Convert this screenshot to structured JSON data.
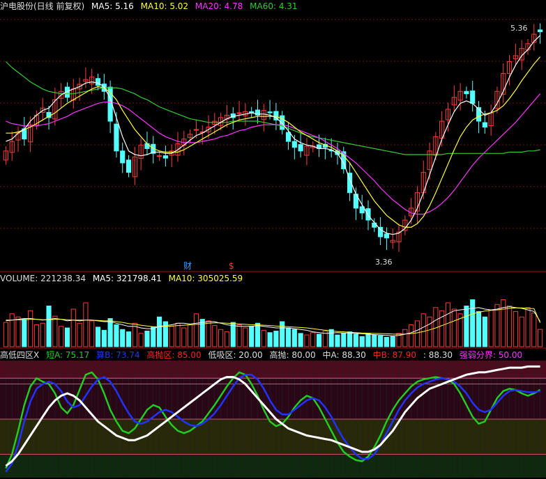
{
  "colors": {
    "bg": "#000000",
    "up": "#ff3b3b",
    "down": "#54ffff",
    "ma5": "#ffffff",
    "ma10": "#ffff33",
    "ma20": "#ff33ff",
    "ma60": "#33cc33",
    "grid": "#7a1010",
    "fin_blue": "#3aa0ff",
    "short_green": "#22cc22",
    "mid_blue": "#2233ff",
    "high_red": "#ff2222",
    "low_white": "#ffffff",
    "strength_magenta": "#ff33ff"
  },
  "chart_data": [
    {
      "type": "candlestick",
      "title": "沪电股份(日线 前复权)",
      "legend": [
        {
          "key": "ma5",
          "label": "MA5: 5.16"
        },
        {
          "key": "ma10",
          "label": "MA10: 5.02"
        },
        {
          "key": "ma20",
          "label": "MA20: 4.78"
        },
        {
          "key": "ma60",
          "label": "MA60: 4.31"
        }
      ],
      "annotations": {
        "high": "5.36",
        "low": "3.36",
        "finance_marker": "财",
        "dollar_marker": "$"
      },
      "ylim": [
        3.3,
        5.45
      ],
      "close": [
        4.3,
        4.38,
        4.45,
        4.4,
        4.52,
        4.6,
        4.66,
        4.58,
        4.73,
        4.8,
        4.75,
        4.82,
        4.86,
        4.9,
        4.92,
        4.85,
        4.8,
        4.55,
        4.3,
        4.2,
        4.12,
        4.25,
        4.35,
        4.32,
        4.28,
        4.26,
        4.24,
        4.3,
        4.36,
        4.4,
        4.44,
        4.48,
        4.46,
        4.5,
        4.55,
        4.58,
        4.6,
        4.58,
        4.62,
        4.63,
        4.62,
        4.6,
        4.64,
        4.62,
        4.56,
        4.48,
        4.38,
        4.33,
        4.3,
        4.34,
        4.34,
        4.32,
        4.33,
        4.3,
        4.27,
        4.15,
        3.95,
        3.82,
        3.78,
        3.72,
        3.66,
        3.58,
        3.57,
        3.55,
        3.62,
        3.72,
        3.82,
        3.95,
        4.12,
        4.3,
        4.42,
        4.55,
        4.65,
        4.75,
        4.8,
        4.78,
        4.7,
        4.55,
        4.5,
        4.62,
        4.8,
        4.95,
        5.05,
        5.1,
        5.16,
        5.2,
        5.28,
        5.3
      ],
      "ma5": [
        4.38,
        4.4,
        4.45,
        4.48,
        4.55,
        4.6,
        4.64,
        4.66,
        4.72,
        4.77,
        4.8,
        4.82,
        4.84,
        4.87,
        4.88,
        4.87,
        4.84,
        4.74,
        4.58,
        4.42,
        4.3,
        4.27,
        4.26,
        4.27,
        4.29,
        4.29,
        4.28,
        4.28,
        4.31,
        4.35,
        4.39,
        4.43,
        4.45,
        4.48,
        4.51,
        4.54,
        4.57,
        4.59,
        4.6,
        4.61,
        4.62,
        4.61,
        4.61,
        4.6,
        4.58,
        4.53,
        4.47,
        4.4,
        4.37,
        4.35,
        4.34,
        4.32,
        4.32,
        4.31,
        4.28,
        4.2,
        4.06,
        3.94,
        3.85,
        3.76,
        3.7,
        3.64,
        3.61,
        3.6,
        3.61,
        3.65,
        3.72,
        3.82,
        3.95,
        4.1,
        4.25,
        4.4,
        4.52,
        4.63,
        4.7,
        4.72,
        4.7,
        4.65,
        4.6,
        4.62,
        4.7,
        4.8,
        4.92,
        5.02,
        5.1,
        5.15,
        5.22,
        5.27
      ],
      "ma10": [
        4.45,
        4.45,
        4.46,
        4.48,
        4.5,
        4.53,
        4.56,
        4.59,
        4.62,
        4.66,
        4.7,
        4.73,
        4.76,
        4.79,
        4.82,
        4.84,
        4.83,
        4.79,
        4.73,
        4.64,
        4.56,
        4.48,
        4.42,
        4.36,
        4.32,
        4.3,
        4.29,
        4.29,
        4.29,
        4.31,
        4.34,
        4.37,
        4.4,
        4.43,
        4.46,
        4.49,
        4.52,
        4.54,
        4.56,
        4.57,
        4.58,
        4.59,
        4.59,
        4.59,
        4.59,
        4.57,
        4.54,
        4.5,
        4.46,
        4.43,
        4.4,
        4.37,
        4.35,
        4.33,
        4.3,
        4.26,
        4.2,
        4.12,
        4.04,
        3.96,
        3.88,
        3.82,
        3.76,
        3.72,
        3.68,
        3.66,
        3.66,
        3.69,
        3.75,
        3.84,
        3.95,
        4.07,
        4.19,
        4.31,
        4.42,
        4.5,
        4.56,
        4.59,
        4.61,
        4.62,
        4.64,
        4.68,
        4.74,
        4.81,
        4.89,
        4.96,
        5.03,
        5.09
      ],
      "ma20": [
        4.55,
        4.53,
        4.52,
        4.51,
        4.51,
        4.51,
        4.52,
        4.53,
        4.55,
        4.57,
        4.59,
        4.62,
        4.64,
        4.66,
        4.68,
        4.7,
        4.71,
        4.71,
        4.7,
        4.68,
        4.65,
        4.61,
        4.57,
        4.53,
        4.49,
        4.45,
        4.42,
        4.4,
        4.38,
        4.37,
        4.37,
        4.37,
        4.38,
        4.39,
        4.4,
        4.42,
        4.43,
        4.45,
        4.47,
        4.48,
        4.5,
        4.51,
        4.52,
        4.52,
        4.52,
        4.52,
        4.51,
        4.49,
        4.47,
        4.45,
        4.43,
        4.41,
        4.38,
        4.35,
        4.32,
        4.28,
        4.24,
        4.2,
        4.15,
        4.1,
        4.05,
        3.99,
        3.94,
        3.89,
        3.85,
        3.81,
        3.78,
        3.77,
        3.77,
        3.79,
        3.82,
        3.86,
        3.91,
        3.97,
        4.04,
        4.11,
        4.18,
        4.24,
        4.29,
        4.34,
        4.39,
        4.44,
        4.49,
        4.54,
        4.6,
        4.66,
        4.72,
        4.78
      ],
      "ma60": [
        5.05,
        5.0,
        4.96,
        4.92,
        4.88,
        4.85,
        4.82,
        4.8,
        4.79,
        4.78,
        4.78,
        4.78,
        4.79,
        4.8,
        4.81,
        4.82,
        4.83,
        4.83,
        4.83,
        4.82,
        4.8,
        4.78,
        4.75,
        4.73,
        4.7,
        4.67,
        4.65,
        4.63,
        4.61,
        4.59,
        4.57,
        4.56,
        4.55,
        4.54,
        4.54,
        4.54,
        4.54,
        4.55,
        4.55,
        4.55,
        4.55,
        4.55,
        4.54,
        4.53,
        4.52,
        4.51,
        4.49,
        4.47,
        4.45,
        4.43,
        4.42,
        4.41,
        4.4,
        4.39,
        4.38,
        4.37,
        4.36,
        4.35,
        4.34,
        4.33,
        4.32,
        4.31,
        4.3,
        4.29,
        4.28,
        4.27,
        4.27,
        4.27,
        4.27,
        4.27,
        4.27,
        4.27,
        4.28,
        4.28,
        4.28,
        4.28,
        4.28,
        4.28,
        4.28,
        4.28,
        4.28,
        4.28,
        4.29,
        4.29,
        4.29,
        4.3,
        4.3,
        4.31
      ]
    },
    {
      "type": "bar",
      "title": "VOLUME",
      "legend": [
        {
          "key": "vol",
          "label": "VOLUME: 221238.34"
        },
        {
          "key": "ma5",
          "label": "MA5: 321798.41"
        },
        {
          "key": "ma10",
          "label": "MA10: 305025.59"
        }
      ],
      "ylim": [
        0,
        800000
      ],
      "volume": [
        310000,
        420000,
        380000,
        350000,
        460000,
        280000,
        300000,
        520000,
        390000,
        260000,
        240000,
        480000,
        300000,
        560000,
        330000,
        250000,
        210000,
        360000,
        280000,
        220000,
        190000,
        300000,
        170000,
        200000,
        250000,
        380000,
        320000,
        260000,
        300000,
        240000,
        280000,
        420000,
        350000,
        330000,
        270000,
        220000,
        190000,
        310000,
        280000,
        240000,
        260000,
        300000,
        210000,
        180000,
        200000,
        320000,
        240000,
        220000,
        170000,
        150000,
        180000,
        160000,
        200000,
        220000,
        150000,
        170000,
        190000,
        160000,
        130000,
        170000,
        150000,
        140000,
        120000,
        130000,
        170000,
        220000,
        280000,
        330000,
        420000,
        380000,
        500000,
        460000,
        560000,
        480000,
        420000,
        520000,
        600000,
        450000,
        380000,
        470000,
        540000,
        600000,
        520000,
        450000,
        380000,
        500000,
        430000,
        221238
      ],
      "ma5": [
        330000,
        340000,
        350000,
        360000,
        360000,
        350000,
        340000,
        350000,
        360000,
        350000,
        330000,
        340000,
        330000,
        340000,
        340000,
        330000,
        320000,
        320000,
        300000,
        280000,
        260000,
        260000,
        240000,
        230000,
        230000,
        260000,
        270000,
        280000,
        300000,
        300000,
        290000,
        300000,
        310000,
        320000,
        320000,
        300000,
        280000,
        270000,
        260000,
        260000,
        260000,
        270000,
        260000,
        250000,
        240000,
        240000,
        240000,
        230000,
        220000,
        210000,
        190000,
        180000,
        170000,
        175000,
        180000,
        175000,
        175000,
        170000,
        165000,
        160000,
        155000,
        150000,
        145000,
        140000,
        145000,
        160000,
        180000,
        210000,
        250000,
        290000,
        340000,
        380000,
        420000,
        460000,
        470000,
        480000,
        490000,
        500000,
        480000,
        470000,
        480000,
        500000,
        510000,
        500000,
        490000,
        470000,
        450000,
        321798
      ],
      "ma10": [
        340000,
        340000,
        345000,
        345000,
        350000,
        350000,
        345000,
        345000,
        350000,
        350000,
        345000,
        340000,
        340000,
        340000,
        340000,
        335000,
        330000,
        330000,
        320000,
        310000,
        295000,
        285000,
        275000,
        265000,
        255000,
        255000,
        260000,
        265000,
        270000,
        275000,
        280000,
        285000,
        290000,
        300000,
        305000,
        305000,
        300000,
        295000,
        290000,
        285000,
        280000,
        280000,
        275000,
        270000,
        265000,
        260000,
        255000,
        250000,
        245000,
        240000,
        230000,
        220000,
        210000,
        200000,
        195000,
        190000,
        185000,
        180000,
        175000,
        172000,
        170000,
        168000,
        165000,
        162000,
        160000,
        162000,
        168000,
        178000,
        195000,
        215000,
        240000,
        270000,
        300000,
        330000,
        360000,
        390000,
        420000,
        440000,
        455000,
        465000,
        470000,
        480000,
        490000,
        495000,
        495000,
        490000,
        485000,
        305025
      ]
    },
    {
      "type": "line",
      "title": "高低四区X",
      "legend": [
        {
          "key": "short",
          "label": "短A: 75.17"
        },
        {
          "key": "mid",
          "label": "算B: 73.74"
        },
        {
          "key": "hiZone",
          "label": "高抛区: 85.00"
        },
        {
          "key": "loZone",
          "label": "低吸区: 20.00"
        },
        {
          "key": "hiThrow",
          "label": "高抛: 80.00"
        },
        {
          "key": "midA",
          "label": "中A: 88.30"
        },
        {
          "key": "midB",
          "label": "中B: 87.90"
        },
        {
          "key": "unnamed",
          "label": ": 88.30"
        },
        {
          "key": "strength",
          "label": "强弱分界: 50.00"
        }
      ],
      "ylim": [
        0,
        100
      ],
      "short_a": [
        8,
        20,
        40,
        62,
        78,
        85,
        82,
        80,
        72,
        60,
        55,
        62,
        75,
        88,
        90,
        84,
        72,
        58,
        48,
        40,
        38,
        42,
        50,
        58,
        62,
        60,
        52,
        45,
        40,
        38,
        40,
        44,
        48,
        55,
        62,
        70,
        78,
        85,
        90,
        88,
        80,
        70,
        58,
        48,
        44,
        46,
        52,
        60,
        66,
        70,
        68,
        60,
        50,
        40,
        30,
        22,
        18,
        15,
        14,
        18,
        26,
        36,
        48,
        58,
        66,
        72,
        78,
        82,
        84,
        85,
        86,
        85,
        84,
        80,
        72,
        62,
        52,
        46,
        48,
        58,
        68,
        74,
        76,
        75,
        72,
        70,
        72,
        75
      ],
      "mid_b": [
        5,
        12,
        28,
        48,
        65,
        76,
        80,
        82,
        80,
        74,
        65,
        60,
        62,
        70,
        78,
        84,
        86,
        82,
        74,
        64,
        55,
        48,
        46,
        48,
        52,
        56,
        58,
        56,
        52,
        48,
        45,
        44,
        46,
        50,
        55,
        62,
        70,
        78,
        85,
        88,
        88,
        84,
        76,
        66,
        58,
        54,
        54,
        58,
        62,
        66,
        68,
        66,
        60,
        52,
        42,
        33,
        26,
        20,
        16,
        16,
        20,
        28,
        38,
        48,
        58,
        66,
        72,
        77,
        80,
        82,
        84,
        85,
        84,
        82,
        78,
        72,
        64,
        58,
        56,
        58,
        64,
        70,
        74,
        75,
        74,
        73,
        73,
        74
      ],
      "long_line": [
        10,
        14,
        20,
        28,
        36,
        44,
        52,
        60,
        66,
        70,
        72,
        70,
        66,
        60,
        54,
        48,
        44,
        40,
        36,
        34,
        32,
        32,
        34,
        36,
        40,
        44,
        48,
        52,
        56,
        60,
        64,
        68,
        72,
        76,
        80,
        84,
        86,
        86,
        84,
        80,
        74,
        68,
        62,
        56,
        50,
        46,
        42,
        40,
        38,
        36,
        35,
        34,
        33,
        32,
        30,
        28,
        26,
        24,
        22,
        22,
        24,
        28,
        34,
        40,
        48,
        56,
        62,
        68,
        72,
        76,
        78,
        80,
        82,
        84,
        86,
        88,
        89,
        90,
        90,
        91,
        92,
        93,
        94,
        94,
        94,
        95,
        95,
        95
      ]
    }
  ]
}
